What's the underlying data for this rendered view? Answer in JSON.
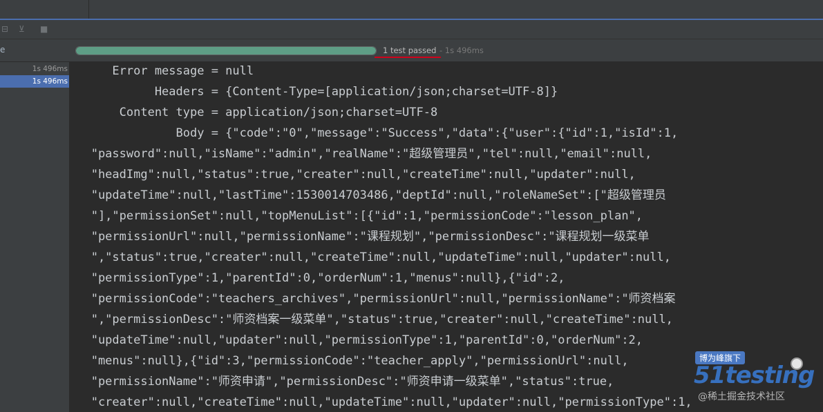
{
  "toolbar": {
    "icons": [
      "collapse-icon",
      "filter-icon",
      "stop-icon"
    ]
  },
  "left_glyph": "e",
  "progress": {
    "fraction": 1.0,
    "status": "1 test passed",
    "time": " - 1s 496ms"
  },
  "tree": [
    {
      "time": "1s 496ms",
      "selected": false
    },
    {
      "time": "1s 496ms",
      "selected": true
    }
  ],
  "console": {
    "lines": [
      "      Error message = null",
      "            Headers = {Content-Type=[application/json;charset=UTF-8]}",
      "       Content type = application/json;charset=UTF-8",
      "               Body = {\"code\":\"0\",\"message\":\"Success\",\"data\":{\"user\":{\"id\":1,\"isId\":1,",
      "   \"password\":null,\"isName\":\"admin\",\"realName\":\"超级管理员\",\"tel\":null,\"email\":null,",
      "   \"headImg\":null,\"status\":true,\"creater\":null,\"createTime\":null,\"updater\":null,",
      "   \"updateTime\":null,\"lastTime\":1530014703486,\"deptId\":null,\"roleNameSet\":[\"超级管理员",
      "   \"],\"permissionSet\":null,\"topMenuList\":[{\"id\":1,\"permissionCode\":\"lesson_plan\",",
      "   \"permissionUrl\":null,\"permissionName\":\"课程规划\",\"permissionDesc\":\"课程规划一级菜单",
      "   \",\"status\":true,\"creater\":null,\"createTime\":null,\"updateTime\":null,\"updater\":null,",
      "   \"permissionType\":1,\"parentId\":0,\"orderNum\":1,\"menus\":null},{\"id\":2,",
      "   \"permissionCode\":\"teachers_archives\",\"permissionUrl\":null,\"permissionName\":\"师资档案",
      "   \",\"permissionDesc\":\"师资档案一级菜单\",\"status\":true,\"creater\":null,\"createTime\":null,",
      "   \"updateTime\":null,\"updater\":null,\"permissionType\":1,\"parentId\":0,\"orderNum\":2,",
      "   \"menus\":null},{\"id\":3,\"permissionCode\":\"teacher_apply\",\"permissionUrl\":null,",
      "   \"permissionName\":\"师资申请\",\"permissionDesc\":\"师资申请一级菜单\",\"status\":true,",
      "   \"creater\":null,\"createTime\":null,\"updateTime\":null,\"updater\":null,\"permissionType\":1,"
    ]
  },
  "watermark": {
    "badge": "博为峰旗下",
    "logo": "51testing",
    "sub": "@稀土掘金技术社区"
  }
}
